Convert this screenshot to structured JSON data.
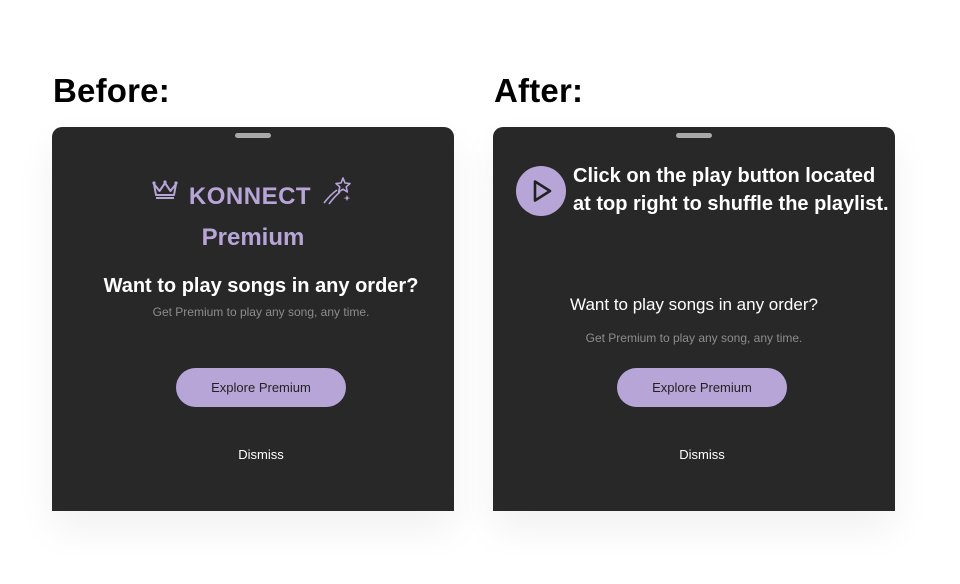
{
  "headings": {
    "before": "Before:",
    "after": "After:"
  },
  "before_panel": {
    "brand": "KONNECT",
    "premium": "Premium",
    "question": "Want to play songs in any order?",
    "subtitle": "Get Premium to play any song, any time.",
    "cta_label": "Explore Premium",
    "dismiss_label": "Dismiss",
    "icons": [
      "crown-icon",
      "shooting-star-icon"
    ]
  },
  "after_panel": {
    "tip": "Click on the play button located at top right to shuffle the playlist.",
    "question": "Want to play songs in any order?",
    "subtitle": "Get Premium to play any song, any time.",
    "cta_label": "Explore Premium",
    "dismiss_label": "Dismiss",
    "icons": [
      "play-icon"
    ]
  },
  "colors": {
    "panel_background": "#282828",
    "accent": "#b7a5d8",
    "handle": "#a9a9a9",
    "muted_text": "#8d8d8d"
  }
}
